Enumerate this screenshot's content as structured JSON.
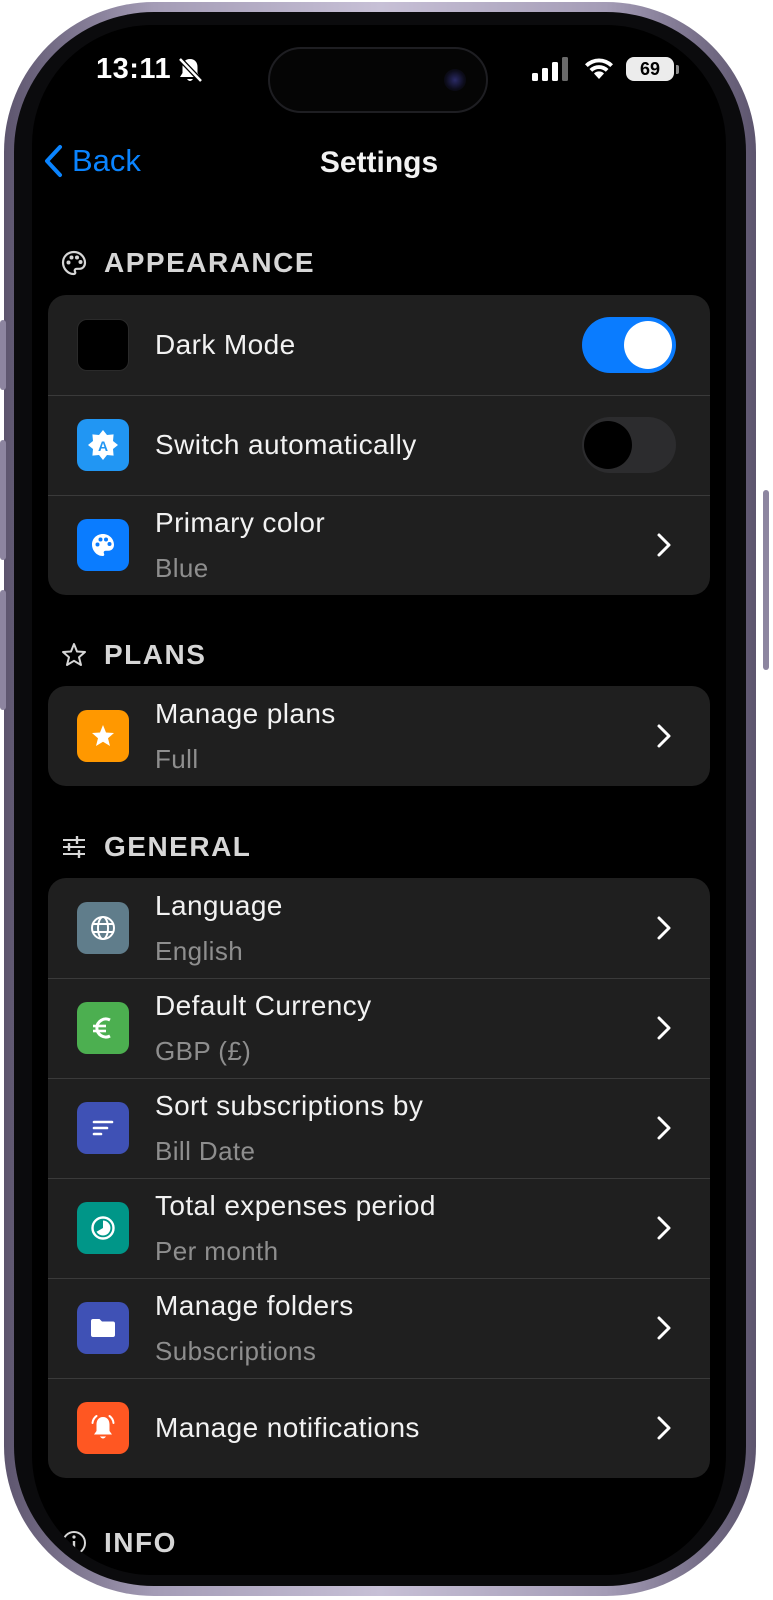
{
  "status_bar": {
    "time": "13:11",
    "battery": "69"
  },
  "nav": {
    "back_label": "Back",
    "title": "Settings"
  },
  "sections": {
    "appearance": {
      "header": "APPEARANCE",
      "rows": {
        "dark_mode": {
          "title": "Dark Mode",
          "toggle": "on"
        },
        "switch_auto": {
          "title": "Switch automatically",
          "toggle": "off"
        },
        "primary_color": {
          "title": "Primary color",
          "subtitle": "Blue"
        }
      }
    },
    "plans": {
      "header": "PLANS",
      "rows": {
        "manage_plans": {
          "title": "Manage plans",
          "subtitle": "Full"
        }
      }
    },
    "general": {
      "header": "GENERAL",
      "rows": {
        "language": {
          "title": "Language",
          "subtitle": "English"
        },
        "currency": {
          "title": "Default Currency",
          "subtitle": "GBP (£)"
        },
        "sort": {
          "title": "Sort subscriptions by",
          "subtitle": "Bill Date"
        },
        "period": {
          "title": "Total expenses period",
          "subtitle": "Per month"
        },
        "folders": {
          "title": "Manage folders",
          "subtitle": "Subscriptions"
        },
        "notifications": {
          "title": "Manage notifications"
        }
      }
    },
    "info": {
      "header": "INFO"
    }
  },
  "icons": {
    "dark_mode": "moon-icon",
    "switch_auto": "auto-brightness-icon",
    "primary_color": "palette-icon",
    "manage_plans": "star-icon",
    "language": "globe-icon",
    "currency": "euro-icon",
    "sort": "sort-icon",
    "period": "clock-icon",
    "folders": "folder-icon",
    "notifications": "bell-ring-icon"
  },
  "colors": {
    "accent": "#0a84ff",
    "toggle_on": "#0a7cff",
    "card_bg": "#1f1f1f",
    "dark_mode_icon_bg": "#000000",
    "switch_auto_icon_bg": "#2196f3",
    "primary_color_icon_bg": "#0a7cff",
    "plans_icon_bg": "#ff9800",
    "language_icon_bg": "#607d8b",
    "currency_icon_bg": "#4caf50",
    "sort_icon_bg": "#3f51b5",
    "period_icon_bg": "#009688",
    "folders_icon_bg": "#3f51b5",
    "notifications_icon_bg": "#ff5722"
  }
}
